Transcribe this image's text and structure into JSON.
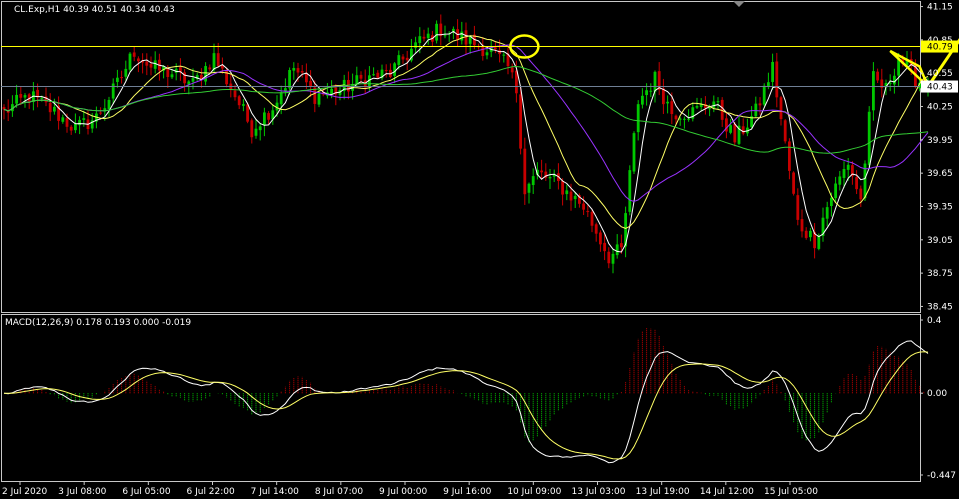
{
  "header": {
    "main": "CL.Exp,H1  40.39 40.51 40.34 40.43",
    "macd": "MACD(12,26,9) 0.178 0.193 0.000 -0.019"
  },
  "colors": {
    "background": "#000000",
    "frame": "#c8c8c8",
    "bull": "#00c800",
    "bear": "#c80000",
    "ma_fast": "#ffffff",
    "ma_yellow": "#ffff66",
    "ma_purple": "#9933ff",
    "ma_green": "#33cc33",
    "hline_yellow": "#ffff00",
    "hline_bid": "#6f7f95",
    "annotation": "#ffff00"
  },
  "chart_data": [
    {
      "type": "candlestick",
      "symbol": "CL.Exp",
      "timeframe": "H1",
      "yticks": [
        41.15,
        40.85,
        40.55,
        40.25,
        39.95,
        39.65,
        39.35,
        39.05,
        38.75,
        38.45
      ],
      "xticks": [
        "2 Jul 2020",
        "3 Jul 08:00",
        "6 Jul 05:00",
        "6 Jul 22:00",
        "7 Jul 14:00",
        "8 Jul 07:00",
        "9 Jul 00:00",
        "9 Jul 16:00",
        "10 Jul 09:00",
        "13 Jul 03:00",
        "13 Jul 19:00",
        "14 Jul 12:00",
        "15 Jul 05:00"
      ],
      "ylim": [
        38.4,
        41.2
      ],
      "price_levels": [
        {
          "label": "40.79",
          "value": 40.79
        },
        {
          "label": "40.43",
          "value": 40.43
        }
      ],
      "close_path": [
        [
          0,
          40.2
        ],
        [
          6,
          40.35
        ],
        [
          12,
          40.2
        ],
        [
          17,
          40.05
        ],
        [
          22,
          40.15
        ],
        [
          27,
          40.45
        ],
        [
          31,
          40.75
        ],
        [
          35,
          40.6
        ],
        [
          40,
          40.55
        ],
        [
          45,
          40.45
        ],
        [
          50,
          40.7
        ],
        [
          55,
          40.35
        ],
        [
          59,
          40.05
        ],
        [
          64,
          40.25
        ],
        [
          69,
          40.6
        ],
        [
          74,
          40.35
        ],
        [
          80,
          40.4
        ],
        [
          86,
          40.5
        ],
        [
          92,
          40.55
        ],
        [
          98,
          40.8
        ],
        [
          104,
          40.95
        ],
        [
          110,
          40.85
        ],
        [
          116,
          40.75
        ],
        [
          120,
          40.6
        ],
        [
          122,
          40.4
        ],
        [
          124,
          39.5
        ],
        [
          127,
          39.65
        ],
        [
          132,
          39.55
        ],
        [
          138,
          39.35
        ],
        [
          144,
          38.9
        ],
        [
          147,
          38.95
        ],
        [
          151,
          40.3
        ],
        [
          155,
          40.5
        ],
        [
          159,
          40.2
        ],
        [
          164,
          40.2
        ],
        [
          169,
          40.3
        ],
        [
          174,
          39.95
        ],
        [
          179,
          40.2
        ],
        [
          183,
          40.6
        ],
        [
          186,
          39.9
        ],
        [
          189,
          39.2
        ],
        [
          193,
          39.05
        ],
        [
          197,
          39.45
        ],
        [
          201,
          39.75
        ],
        [
          204,
          39.4
        ],
        [
          207,
          40.5
        ],
        [
          210,
          40.4
        ],
        [
          213,
          40.7
        ],
        [
          217,
          40.5
        ],
        [
          220,
          40.43
        ]
      ],
      "n_bars": 221,
      "moving_averages": [
        {
          "period": 5,
          "color_key": "ma_fast"
        },
        {
          "period": 14,
          "color_key": "ma_yellow"
        },
        {
          "period": 28,
          "color_key": "ma_purple"
        },
        {
          "period": 60,
          "color_key": "ma_green"
        }
      ]
    },
    {
      "type": "macd",
      "params": [
        12,
        26,
        9
      ],
      "values": {
        "main": 0.178,
        "signal": 0.193,
        "histogram_a": 0.0,
        "histogram_b": -0.019
      },
      "yticks": [
        0.4,
        0.0,
        -0.447
      ],
      "ylim": [
        -0.447,
        0.4
      ]
    }
  ],
  "annotations": [
    {
      "type": "ellipse",
      "bar": 122,
      "price": 40.79
    },
    {
      "type": "triangle",
      "bars": [
        211,
        220,
        218
      ],
      "prices": [
        40.75,
        40.43,
        40.61
      ]
    },
    {
      "type": "arrow",
      "from_bar": 220,
      "from_price": 40.43,
      "to_bar": 232,
      "to_price": 41.1
    }
  ]
}
